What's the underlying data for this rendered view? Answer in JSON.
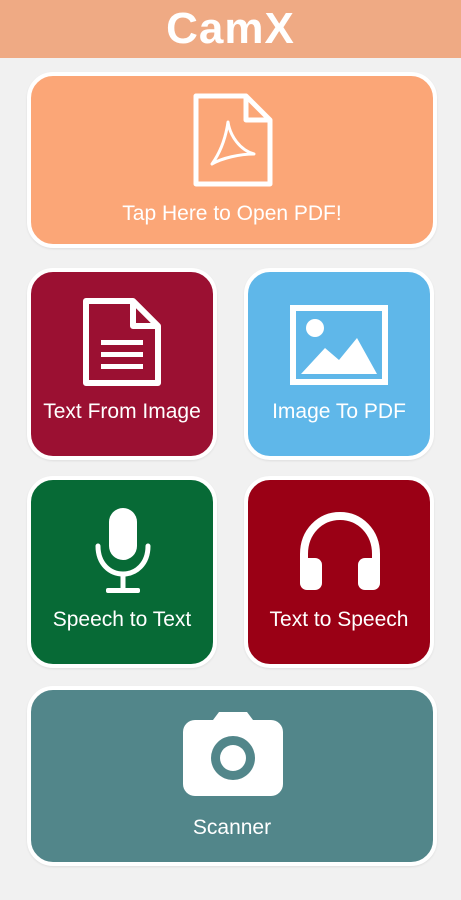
{
  "app": {
    "title": "CamX",
    "colors": {
      "header": "#efaa84",
      "background": "#f1f1f1"
    }
  },
  "tiles": {
    "open_pdf": {
      "label": "Tap Here to Open PDF!",
      "icon": "pdf-file-icon",
      "color": "#fba677"
    },
    "text_from_image": {
      "label": "Text From Image",
      "icon": "document-text-icon",
      "color": "#9b1032"
    },
    "image_to_pdf": {
      "label": "Image To PDF",
      "icon": "image-icon",
      "color": "#5fb7e9"
    },
    "speech_to_text": {
      "label": "Speech to Text",
      "icon": "microphone-icon",
      "color": "#076a36"
    },
    "text_to_speech": {
      "label": "Text to Speech",
      "icon": "headphones-icon",
      "color": "#9a0015"
    },
    "scanner": {
      "label": "Scanner",
      "icon": "camera-icon",
      "color": "#52868a"
    }
  }
}
